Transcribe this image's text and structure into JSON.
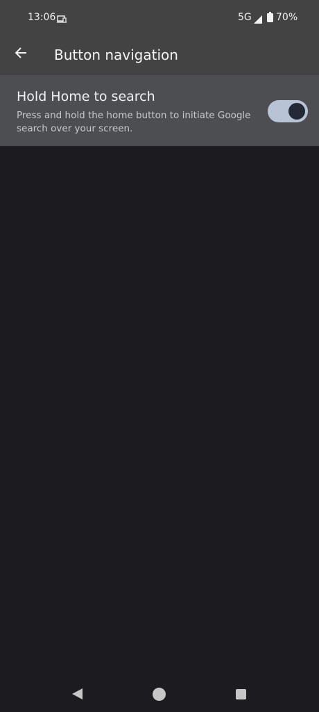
{
  "status_bar": {
    "time": "13:06",
    "network": "5G",
    "battery": "70%",
    "icons": [
      "cast-icon",
      "signal-icon",
      "battery-icon"
    ]
  },
  "app_bar": {
    "title": "Button navigation",
    "back_icon": "arrow-back-icon"
  },
  "setting": {
    "title": "Hold Home to search",
    "summary": "Press and hold the home button to initiate Google search over your screen.",
    "enabled": true
  },
  "nav_bar": {
    "icons": [
      "nav-back-icon",
      "nav-home-icon",
      "nav-recents-icon"
    ]
  },
  "colors": {
    "background": "#1c1b20",
    "top_bar": "#434343",
    "row": "#4c4e52",
    "toggle_track": "#b9c3d6",
    "toggle_knob": "#232a35"
  }
}
